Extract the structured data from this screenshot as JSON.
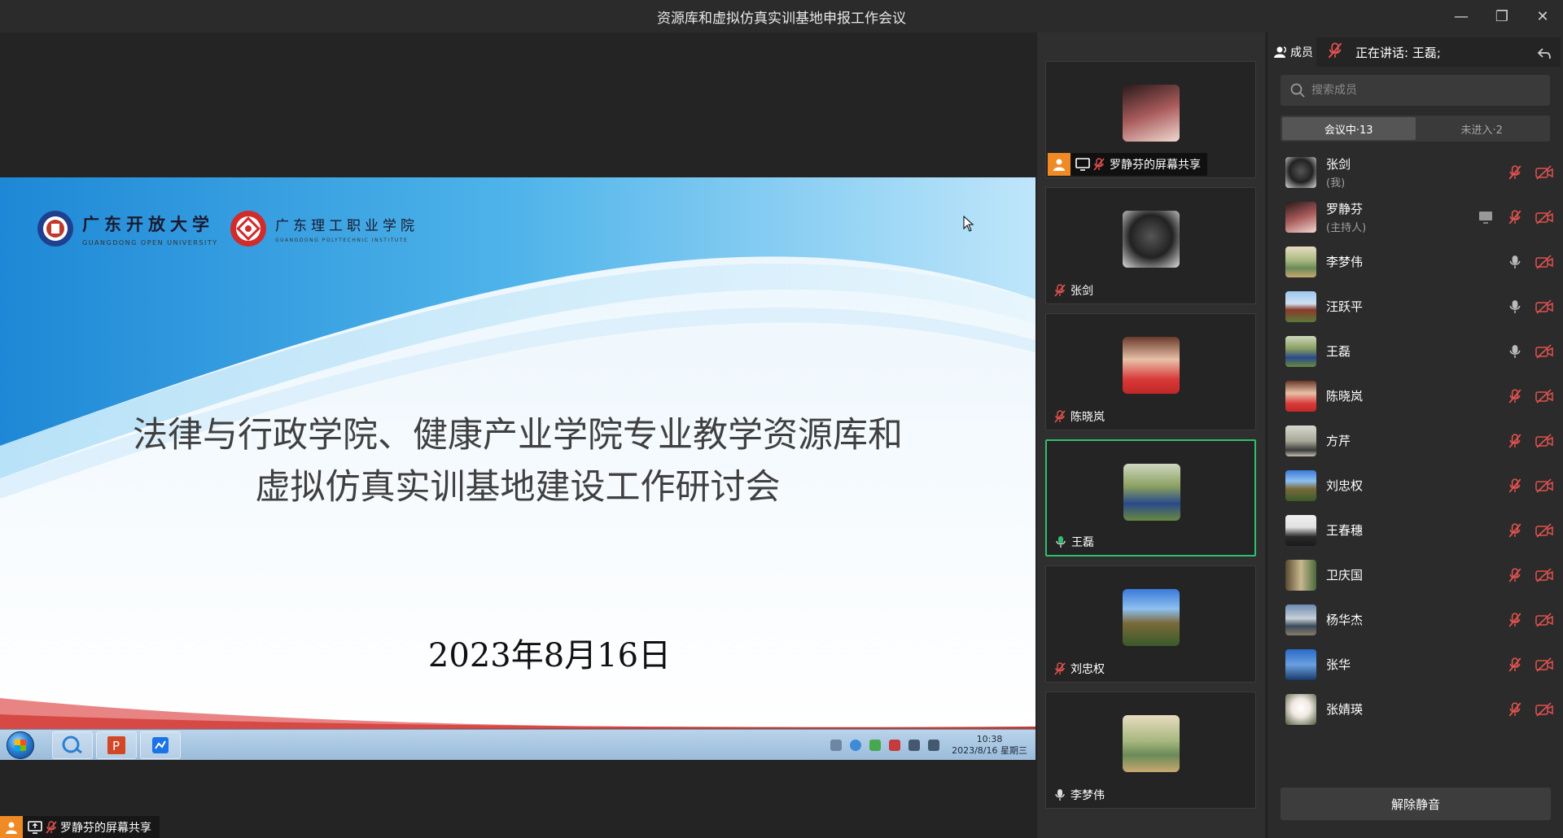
{
  "window": {
    "title": "资源库和虚拟仿真实训基地申报工作会议",
    "controls": [
      "—",
      "❐",
      "✕"
    ]
  },
  "slide": {
    "logo1_cn": "广东开放大学",
    "logo1_en": "GUANGDONG OPEN UNIVERSITY",
    "logo2_cn": "广东理工职业学院",
    "logo2_en": "GUANGDONG POLYTECHNIC INSTITUTE",
    "title_line1": "法律与行政学院、健康产业学院专业教学资源库和",
    "title_line2": "虚拟仿真实训基地建设工作研讨会",
    "date": "2023年8月16日"
  },
  "taskbar": {
    "time": "10:38",
    "date": "2023/8/16 星期三"
  },
  "share_badge": {
    "label": "罗静芬的屏幕共享"
  },
  "video_tiles": [
    {
      "name": "罗静芬的屏幕共享",
      "sharing": true,
      "speaking": false,
      "mic": "muted"
    },
    {
      "name": "张剑",
      "sharing": false,
      "speaking": false,
      "mic": "muted"
    },
    {
      "name": "陈晓岚",
      "sharing": false,
      "speaking": false,
      "mic": "muted"
    },
    {
      "name": "王磊",
      "sharing": false,
      "speaking": true,
      "mic": "on"
    },
    {
      "name": "刘忠权",
      "sharing": false,
      "speaking": false,
      "mic": "muted"
    },
    {
      "name": "李梦伟",
      "sharing": false,
      "speaking": false,
      "mic": "on"
    }
  ],
  "panel": {
    "members_tab": "成员",
    "speaking_label": "正在讲话: 王磊;",
    "search_placeholder": "搜索成员",
    "tab_in_meeting": "会议中·13",
    "tab_not_joined": "未进入·2",
    "unmute_label": "解除静音"
  },
  "members": [
    {
      "name": "张剑",
      "sub": "(我)",
      "mic": "muted",
      "screen": false
    },
    {
      "name": "罗静芬",
      "sub": "(主持人)",
      "mic": "muted",
      "screen": true
    },
    {
      "name": "李梦伟",
      "sub": "",
      "mic": "on",
      "screen": false
    },
    {
      "name": "汪跃平",
      "sub": "",
      "mic": "on",
      "screen": false
    },
    {
      "name": "王磊",
      "sub": "",
      "mic": "on",
      "screen": false
    },
    {
      "name": "陈晓岚",
      "sub": "",
      "mic": "muted",
      "screen": false
    },
    {
      "name": "方芹",
      "sub": "",
      "mic": "muted",
      "screen": false
    },
    {
      "name": "刘忠权",
      "sub": "",
      "mic": "muted",
      "screen": false
    },
    {
      "name": "王春穗",
      "sub": "",
      "mic": "muted",
      "screen": false
    },
    {
      "name": "卫庆国",
      "sub": "",
      "mic": "muted",
      "screen": false
    },
    {
      "name": "杨华杰",
      "sub": "",
      "mic": "muted",
      "screen": false
    },
    {
      "name": "张华",
      "sub": "",
      "mic": "muted",
      "screen": false
    },
    {
      "name": "张婧瑛",
      "sub": "",
      "mic": "muted",
      "screen": false
    }
  ],
  "colors": {
    "accent_green": "#2fbf6d",
    "share_orange": "#f08a24",
    "muted_red": "#e0524f"
  }
}
